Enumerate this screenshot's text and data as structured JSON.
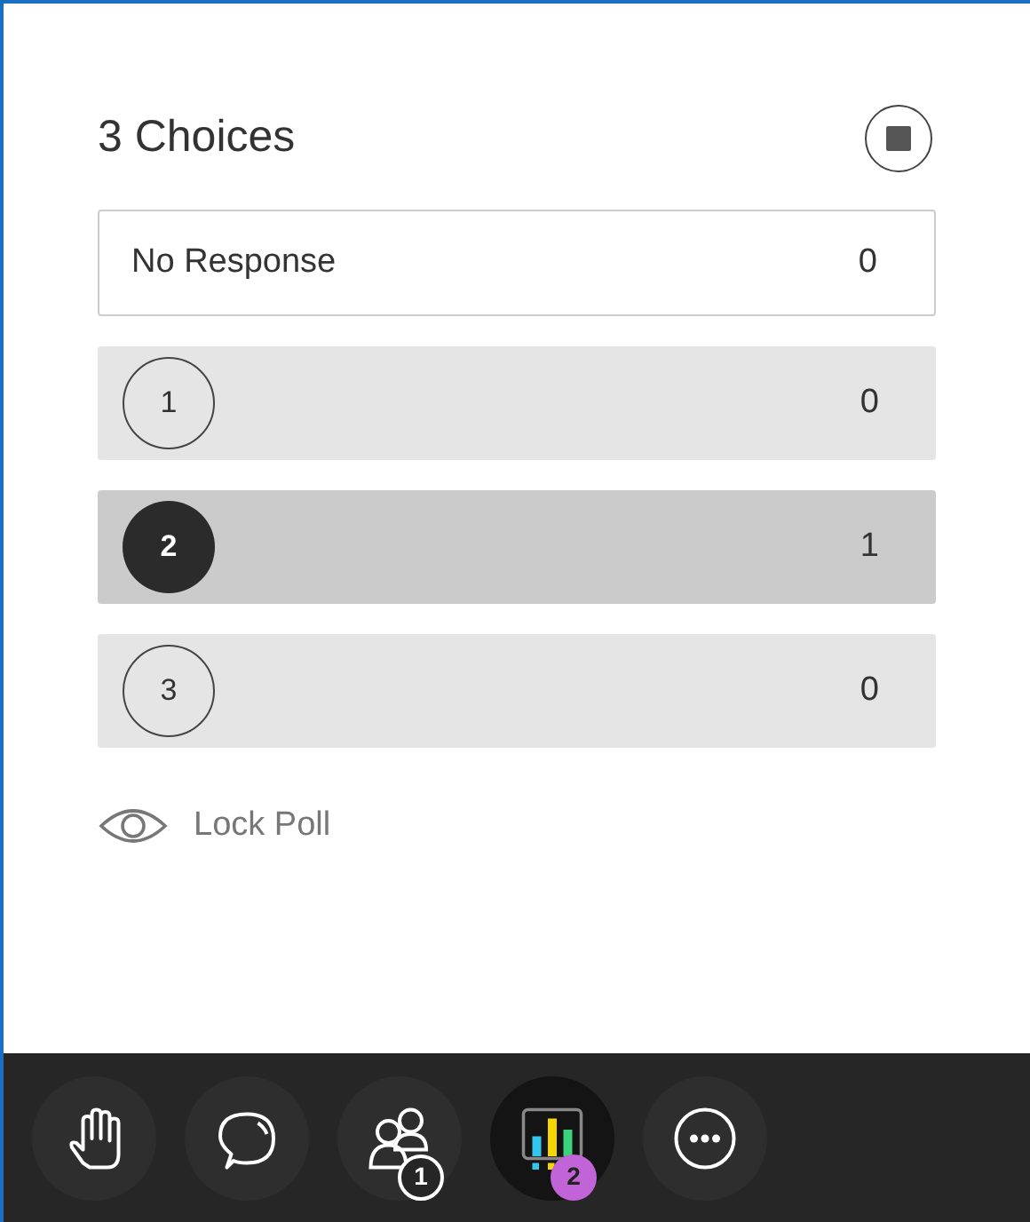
{
  "poll": {
    "title": "3 Choices",
    "no_response": {
      "label": "No Response",
      "count": "0"
    },
    "choices": [
      {
        "number": "1",
        "count": "0",
        "selected": false
      },
      {
        "number": "2",
        "count": "1",
        "selected": true
      },
      {
        "number": "3",
        "count": "0",
        "selected": false
      }
    ],
    "lock_label": "Lock Poll"
  },
  "toolbar": [
    {
      "kind": "hand",
      "selected": false
    },
    {
      "kind": "chat",
      "selected": false
    },
    {
      "kind": "people",
      "selected": false,
      "badge": "1"
    },
    {
      "kind": "poll",
      "selected": true,
      "badge": "2"
    },
    {
      "kind": "more",
      "selected": false
    }
  ]
}
